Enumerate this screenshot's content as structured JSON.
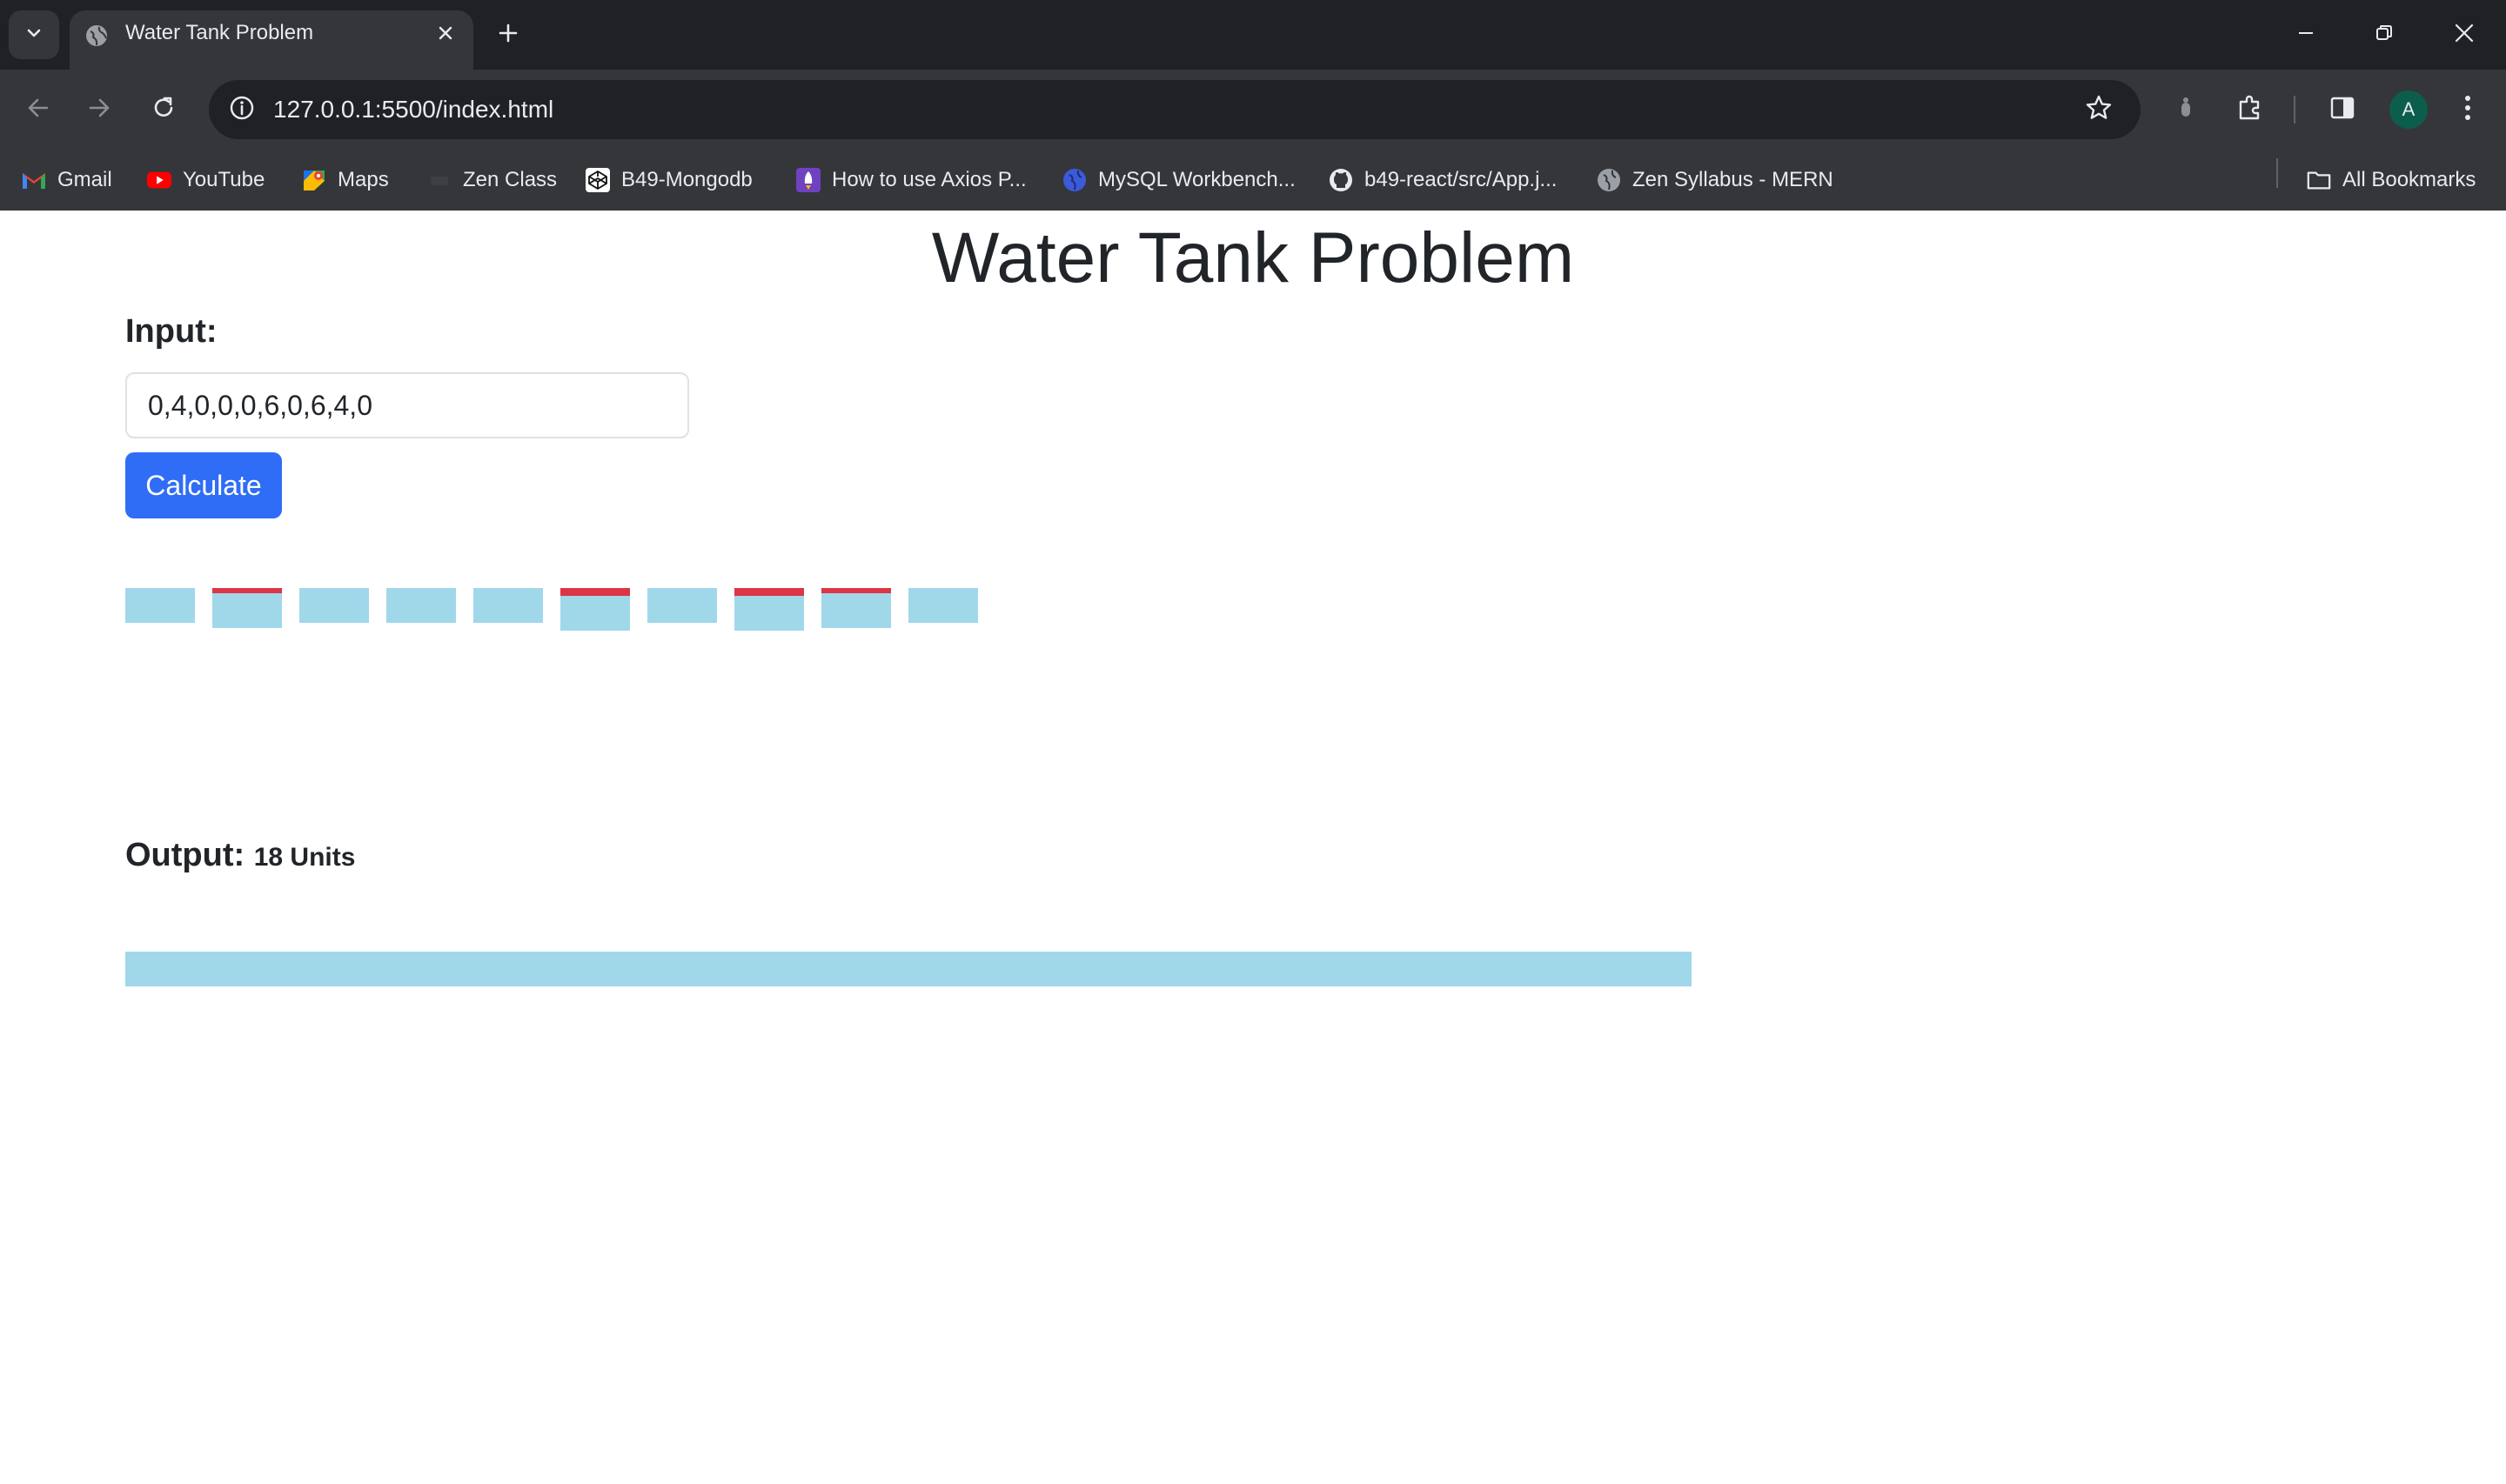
{
  "browser": {
    "tab": {
      "title": "Water Tank Problem"
    },
    "address": {
      "url": "127.0.0.1:5500/index.html"
    },
    "profile": {
      "initial": "A"
    },
    "bookmarks": [
      {
        "label": "Gmail",
        "icon": "gmail-icon"
      },
      {
        "label": "YouTube",
        "icon": "youtube-icon"
      },
      {
        "label": "Maps",
        "icon": "maps-icon"
      },
      {
        "label": "Zen Class",
        "icon": "zen-class-icon"
      },
      {
        "label": "B49-Mongodb",
        "icon": "codepen-icon"
      },
      {
        "label": "How to use Axios P...",
        "icon": "rocket-icon"
      },
      {
        "label": "MySQL Workbench...",
        "icon": "globe-icon"
      },
      {
        "label": "b49-react/src/App.j...",
        "icon": "github-icon"
      },
      {
        "label": "Zen Syllabus - MERN",
        "icon": "globe-icon"
      }
    ],
    "all_bookmarks": "All Bookmarks"
  },
  "page": {
    "title": "Water Tank Problem",
    "input_label": "Input:",
    "input_value": "0,4,0,0,0,6,0,6,4,0",
    "button_label": "Calculate",
    "output_label": "Output:",
    "output_value": "18 Units",
    "tank_heights": [
      0,
      4,
      0,
      0,
      0,
      6,
      0,
      6,
      4,
      0
    ],
    "colors": {
      "block": "#dc3545",
      "water": "#a0d8ea",
      "button": "#2f6df6"
    }
  }
}
